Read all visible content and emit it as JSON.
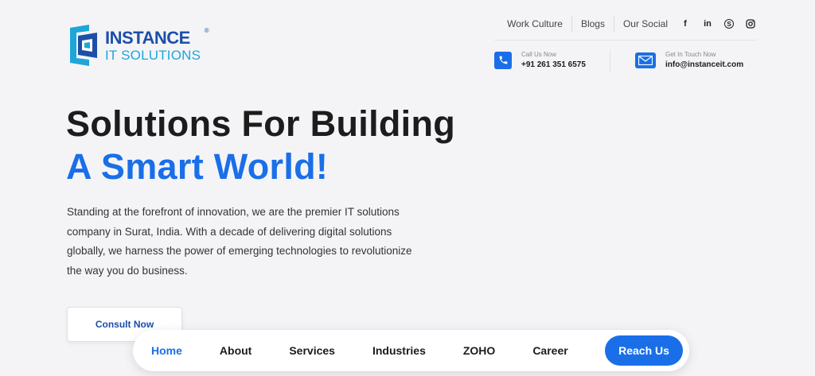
{
  "logo": {
    "line1": "INSTANCE",
    "reg": "®",
    "line2": "IT SOLUTIONS"
  },
  "topnav": {
    "links": [
      "Work Culture",
      "Blogs",
      "Our Social"
    ]
  },
  "social": [
    {
      "icon": "facebook-icon",
      "glyph": "f"
    },
    {
      "icon": "linkedin-icon",
      "glyph": "in"
    },
    {
      "icon": "skype-icon",
      "glyph": "S"
    },
    {
      "icon": "instagram-icon",
      "glyph": "◎"
    }
  ],
  "contact": {
    "phone": {
      "label": "Call Us Now",
      "value": "+91 261 351 6575"
    },
    "mail": {
      "label": "Get In Touch Now",
      "value": "info@instanceit.com"
    }
  },
  "hero": {
    "title_line1": "Solutions For Building",
    "title_line2": "A Smart World!",
    "description": "Standing at the forefront of innovation, we are the premier IT solutions company in Surat, India. With a decade of delivering digital solutions globally, we harness the power of emerging technologies to revolutionize the way you do business.",
    "cta": "Consult Now"
  },
  "bottomnav": {
    "items": [
      "Home",
      "About",
      "Services",
      "Industries",
      "ZOHO",
      "Career"
    ],
    "active": "Home",
    "reach": "Reach Us"
  },
  "colors": {
    "accent": "#1a6fe8",
    "logo_dark": "#1d4fa8",
    "logo_light": "#1ea6d9",
    "bg": "#f4f4f7"
  }
}
